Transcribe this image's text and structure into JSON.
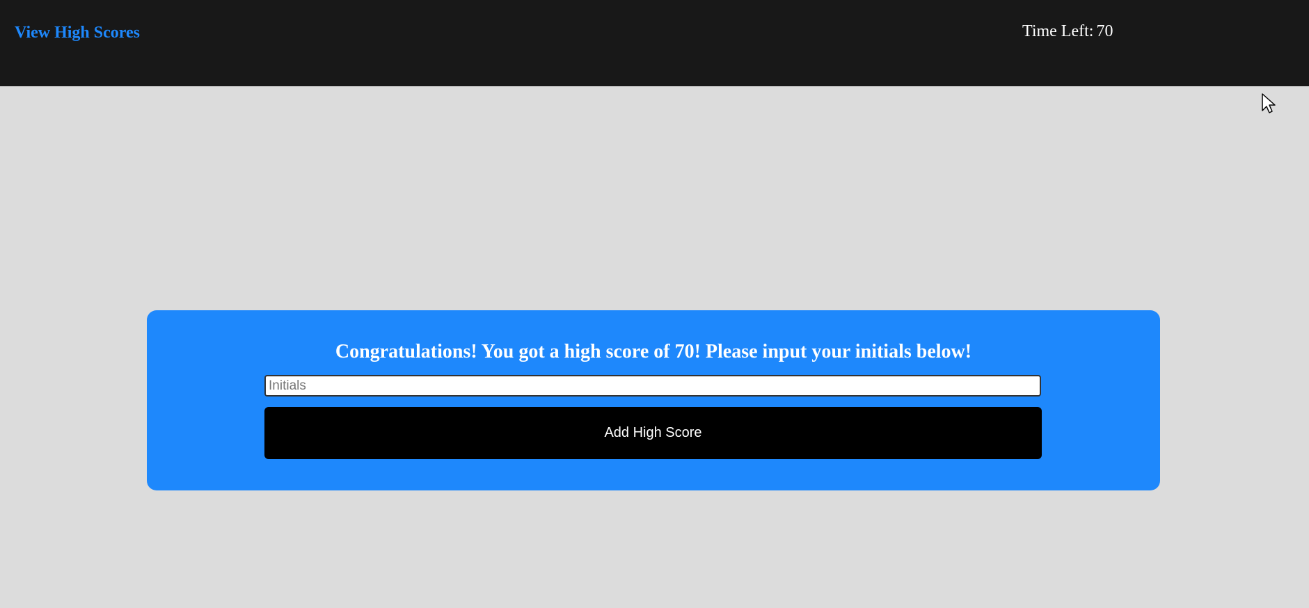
{
  "header": {
    "high_scores_link": "View High Scores",
    "timer_label": "Time Left:",
    "timer_value": "70"
  },
  "highscore_form": {
    "message": "Congratulations! You got a high score of 70! Please input your initials below!",
    "initials_placeholder": "Initials",
    "initials_value": "",
    "submit_label": "Add High Score"
  },
  "colors": {
    "header_background": "#181818",
    "page_background": "#dcdcdc",
    "accent_blue": "#1e88fc",
    "button_background": "#000000",
    "text_light": "#ffffff"
  },
  "icons": {
    "pointer": "mouse-pointer-icon"
  }
}
